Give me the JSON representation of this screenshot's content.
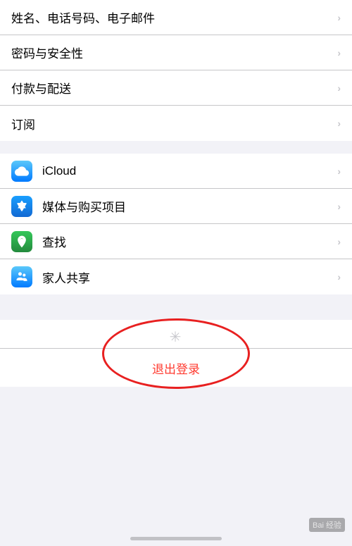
{
  "settings": {
    "group1": {
      "items": [
        {
          "id": "name-phone-email",
          "label": "姓名、电话号码、电子邮件",
          "hasIcon": false
        },
        {
          "id": "password-security",
          "label": "密码与安全性",
          "hasIcon": false
        },
        {
          "id": "payment-delivery",
          "label": "付款与配送",
          "hasIcon": false
        },
        {
          "id": "subscriptions",
          "label": "订阅",
          "hasIcon": false
        }
      ]
    },
    "group2": {
      "items": [
        {
          "id": "icloud",
          "label": "iCloud",
          "iconType": "icloud"
        },
        {
          "id": "media-purchases",
          "label": "媒体与购买项目",
          "iconType": "appstore"
        },
        {
          "id": "findmy",
          "label": "查找",
          "iconType": "findmy"
        },
        {
          "id": "family-sharing",
          "label": "家人共享",
          "iconType": "family"
        }
      ]
    },
    "signout": {
      "label": "退出登录"
    },
    "chevron": "›",
    "watermark": "Bai 经验"
  }
}
